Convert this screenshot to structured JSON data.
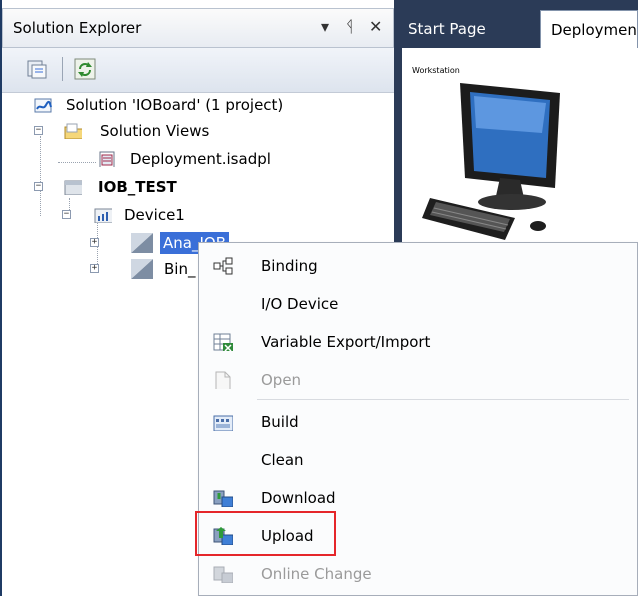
{
  "solution_explorer": {
    "title": "Solution Explorer",
    "controls": {
      "dropdown": "▾",
      "pin": "ᛩ",
      "close": "✕"
    },
    "tree": {
      "solution": "Solution 'IOBoard' (1 project)",
      "solution_views": "Solution Views",
      "deployment_file": "Deployment.isadpl",
      "project": "IOB_TEST",
      "device": "Device1",
      "item_ana": "Ana_IOB",
      "item_bin": "Bin_"
    }
  },
  "tabs": [
    {
      "label": "Start Page"
    },
    {
      "label": "Deploymen"
    }
  ],
  "canvas": {
    "workstation_label": "Workstation"
  },
  "context_menu": {
    "items": [
      {
        "label": "Binding",
        "icon": "binding-icon",
        "enabled": true
      },
      {
        "label": "I/O Device",
        "icon": "",
        "enabled": true
      },
      {
        "label": "Variable Export/Import",
        "icon": "variable-export-icon",
        "enabled": true
      },
      {
        "label": "Open",
        "icon": "open-document-icon",
        "enabled": false
      },
      {
        "label": "Build",
        "icon": "build-icon",
        "enabled": true
      },
      {
        "label": "Clean",
        "icon": "",
        "enabled": true
      },
      {
        "label": "Download",
        "icon": "download-icon",
        "enabled": true
      },
      {
        "label": "Upload",
        "icon": "upload-icon",
        "enabled": true,
        "highlighted": true
      },
      {
        "label": "Online Change",
        "icon": "online-change-icon",
        "enabled": false
      }
    ]
  },
  "colors": {
    "selection": "#3a6fd8",
    "highlight_box": "#e5262a",
    "doc_background": "#2b3b57"
  }
}
